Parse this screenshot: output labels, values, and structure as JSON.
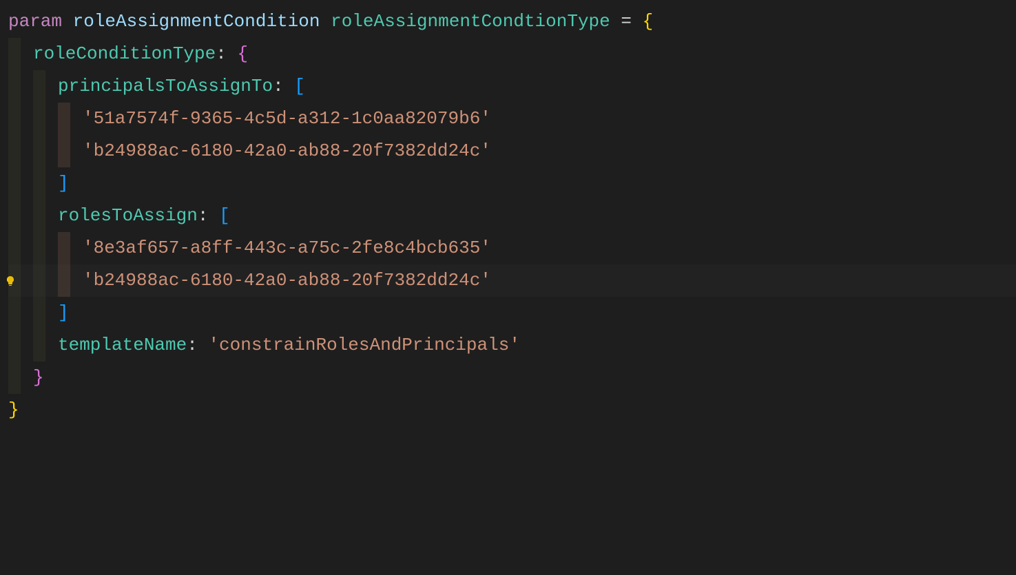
{
  "code": {
    "line1": {
      "keyword": "param",
      "varName": "roleAssignmentCondition",
      "typeName": "roleAssignmentCondtionType",
      "equals": " = ",
      "brace": "{"
    },
    "line2": {
      "prop": "roleConditionType",
      "colon": ": ",
      "brace": "{"
    },
    "line3": {
      "prop": "principalsToAssignTo",
      "colon": ": ",
      "bracket": "["
    },
    "line4": {
      "string": "'51a7574f-9365-4c5d-a312-1c0aa82079b6'"
    },
    "line5": {
      "string": "'b24988ac-6180-42a0-ab88-20f7382dd24c'"
    },
    "line6": {
      "bracket": "]"
    },
    "line7": {
      "prop": "rolesToAssign",
      "colon": ": ",
      "bracket": "["
    },
    "line8": {
      "string": "'8e3af657-a8ff-443c-a75c-2fe8c4bcb635'"
    },
    "line9": {
      "string": "'b24988ac-6180-42a0-ab88-20f7382dd24c'"
    },
    "line10": {
      "bracket": "]"
    },
    "line11": {
      "prop": "templateName",
      "colon": ": ",
      "string": "'constrainRolesAndPrincipals'"
    },
    "line12": {
      "brace": "}"
    },
    "line13": {
      "brace": "}"
    }
  }
}
